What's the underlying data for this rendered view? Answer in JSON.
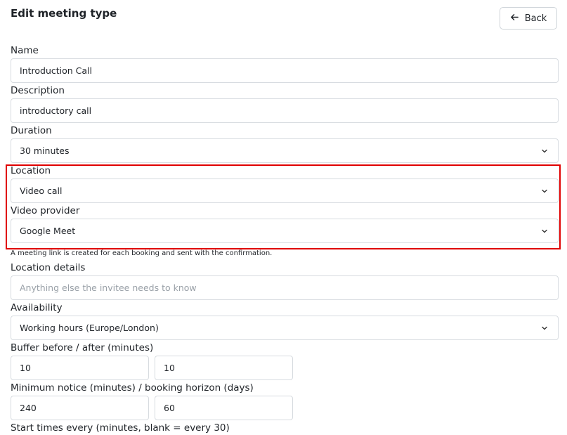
{
  "header": {
    "title": "Edit meeting type",
    "back_label": "Back"
  },
  "form": {
    "name": {
      "label": "Name",
      "value": "Introduction Call"
    },
    "description": {
      "label": "Description",
      "value": "introductory call"
    },
    "duration": {
      "label": "Duration",
      "value": "30 minutes"
    },
    "location": {
      "label": "Location",
      "value": "Video call"
    },
    "video_provider": {
      "label": "Video provider",
      "value": "Google Meet",
      "help": "A meeting link is created for each booking and sent with the confirmation."
    },
    "location_details": {
      "label": "Location details",
      "placeholder": "Anything else the invitee needs to know",
      "value": ""
    },
    "availability": {
      "label": "Availability",
      "value": "Working hours (Europe/London)"
    },
    "buffer": {
      "label": "Buffer before / after (minutes)",
      "before": "10",
      "after": "10"
    },
    "notice": {
      "label": "Minimum notice (minutes) / booking horizon (days)",
      "minimum": "240",
      "horizon": "60"
    },
    "start_times": {
      "label": "Start times every (minutes, blank = every 30)"
    }
  },
  "highlight_color": "#e00000",
  "icons": {
    "back": "arrow-left-icon",
    "select": "chevron-down-icon"
  }
}
